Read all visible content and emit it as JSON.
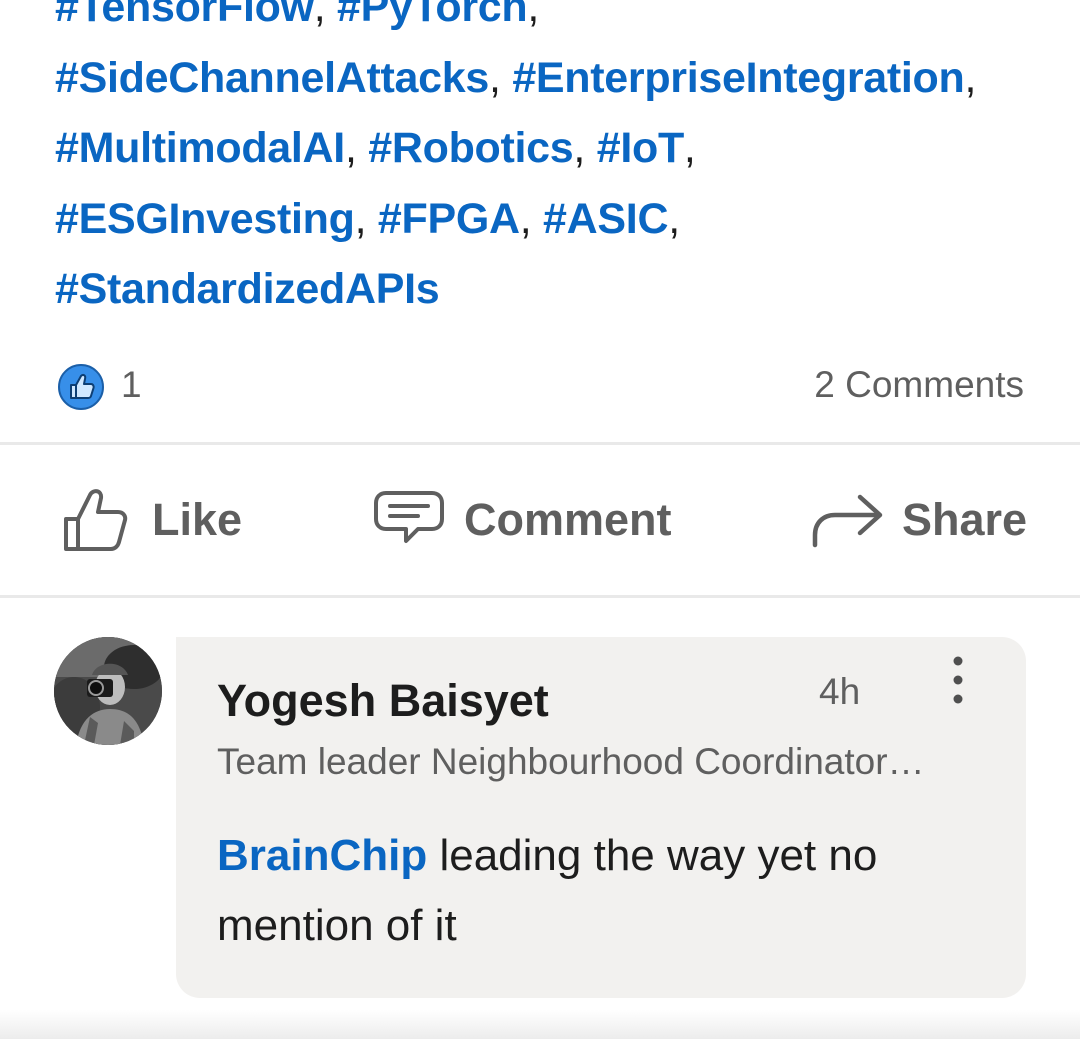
{
  "post": {
    "hashtag_lines": [
      [
        {
          "text": "#TensorFlow",
          "sep": ", "
        },
        {
          "text": "#PyTorch",
          "sep": ","
        }
      ],
      [
        {
          "text": "#SideChannelAttacks",
          "sep": ", "
        },
        {
          "text": "#EnterpriseIntegration",
          "sep": ","
        }
      ],
      [
        {
          "text": "#MultimodalAI",
          "sep": ", "
        },
        {
          "text": "#Robotics",
          "sep": ", "
        },
        {
          "text": "#IoT",
          "sep": ","
        }
      ],
      [
        {
          "text": "#ESGInvesting",
          "sep": ", "
        },
        {
          "text": "#FPGA",
          "sep": ", "
        },
        {
          "text": "#ASIC",
          "sep": ","
        }
      ],
      [
        {
          "text": "#StandardizedAPIs",
          "sep": ""
        }
      ]
    ]
  },
  "social": {
    "reaction_icon": "like-thumb-icon",
    "reaction_count": "1",
    "comments_label": "2 Comments"
  },
  "actions": {
    "like": {
      "label": "Like",
      "icon": "thumbs-up-icon"
    },
    "comment": {
      "label": "Comment",
      "icon": "speech-bubble-icon"
    },
    "share": {
      "label": "Share",
      "icon": "share-arrow-icon"
    }
  },
  "comment": {
    "author": "Yogesh Baisyet",
    "time": "4h",
    "headline": "Team leader Neighbourhood Coordinator…",
    "mention": "BrainChip",
    "text": " leading the way yet no mention of it",
    "more_icon": "more-vertical-icon"
  },
  "colors": {
    "link": "#0a66c2",
    "text_primary": "#1d1d1d",
    "text_secondary": "#5f5f5f",
    "bubble_bg": "#f2f1ef",
    "divider": "#e9e9e9"
  }
}
